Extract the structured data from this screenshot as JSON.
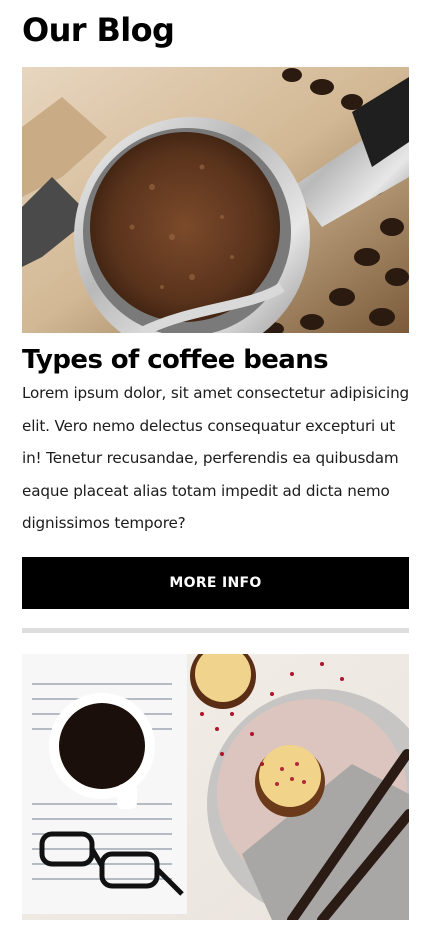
{
  "page": {
    "title": "Our Blog"
  },
  "posts": [
    {
      "image": "espresso-portafilter-with-coffee-grounds",
      "title": "Types of coffee beans",
      "excerpt": "Lorem ipsum dolor, sit amet consectetur adipisicing elit. Vero nemo delectus consequatur excepturi ut in! Tenetur recusandae, perferendis ea quibusdam eaque placeat alias totam impedit ad dicta nemo dignissimos tempore?",
      "button_label": "MORE INFO"
    },
    {
      "image": "coffee-cup-with-glasses-and-cupcake"
    }
  ],
  "colors": {
    "button_background": "#000000",
    "button_text": "#ffffff",
    "divider": "#dedede"
  }
}
